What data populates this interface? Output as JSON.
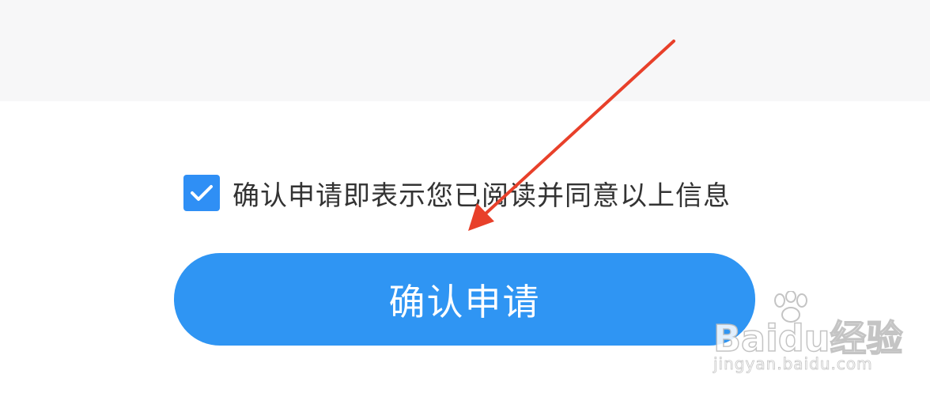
{
  "agreement": {
    "checked": true,
    "text": "确认申请即表示您已阅读并同意以上信息"
  },
  "confirm_button": {
    "label": "确认申请"
  },
  "colors": {
    "primary": "#2f95f3",
    "checkbox": "#2f8ff5",
    "text": "#333333",
    "arrow": "#e8402a",
    "top_band": "#f7f7f8"
  },
  "watermark": {
    "brand": "Baidu经验",
    "url": "jingyan.baidu.com"
  }
}
